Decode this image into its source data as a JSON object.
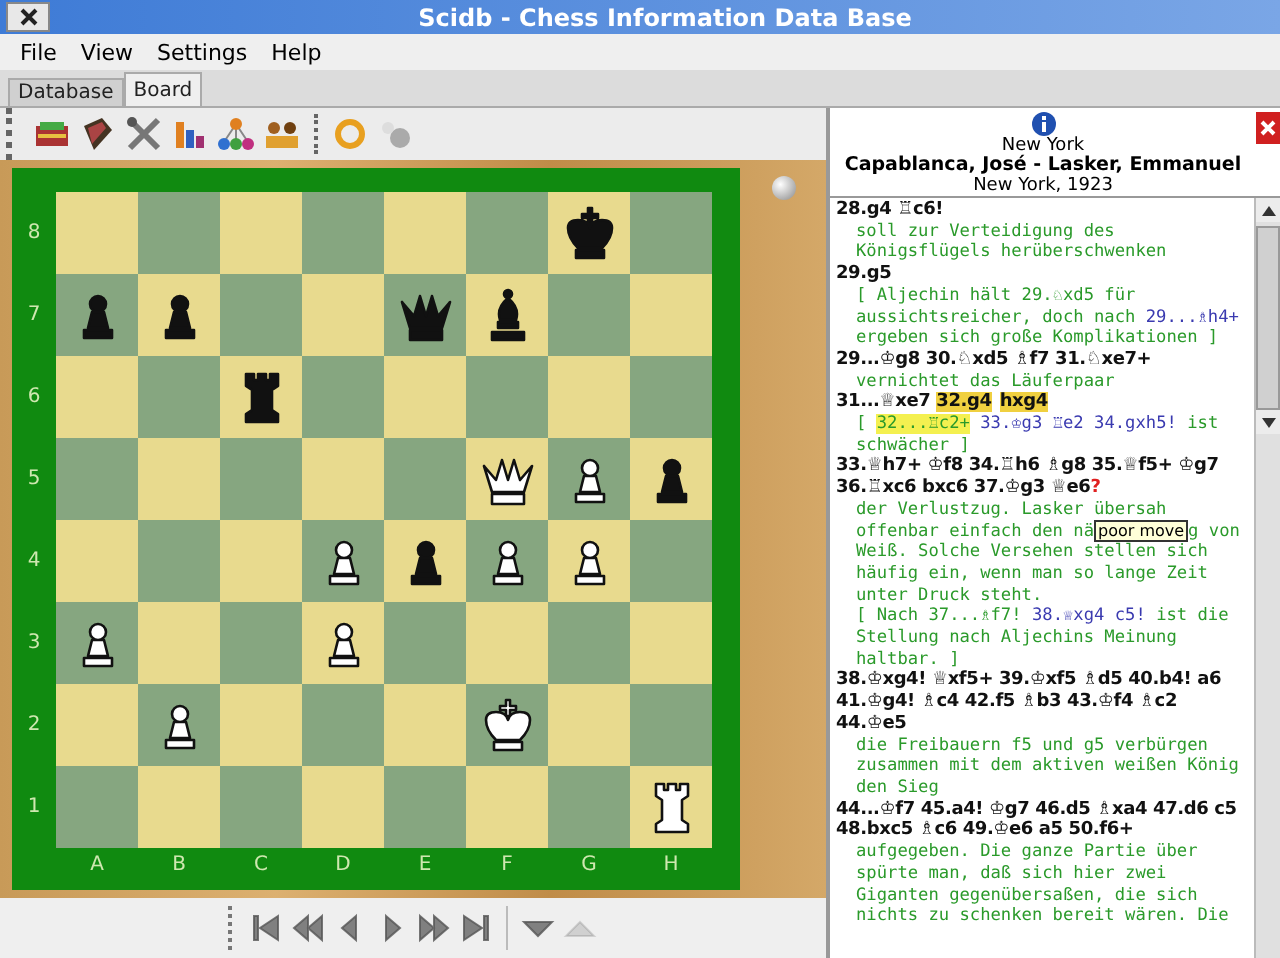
{
  "window": {
    "title": "Scidb - Chess Information Data Base"
  },
  "menu": [
    {
      "label": "File"
    },
    {
      "label": "View"
    },
    {
      "label": "Settings"
    },
    {
      "label": "Help"
    }
  ],
  "tabs": [
    {
      "label": "Database",
      "selected": false
    },
    {
      "label": "Board",
      "selected": true
    }
  ],
  "board": {
    "ranks": [
      "8",
      "7",
      "6",
      "5",
      "4",
      "3",
      "2",
      "1"
    ],
    "files": [
      "A",
      "B",
      "C",
      "D",
      "E",
      "F",
      "G",
      "H"
    ],
    "rows": [
      [
        {
          "kind": "empty"
        },
        {
          "kind": "empty"
        },
        {
          "kind": "empty"
        },
        {
          "kind": "empty"
        },
        {
          "kind": "empty"
        },
        {
          "kind": "empty"
        },
        {
          "kind": "black-king"
        },
        {
          "kind": "empty"
        }
      ],
      [
        {
          "kind": "black-pawn"
        },
        {
          "kind": "black-pawn"
        },
        {
          "kind": "empty"
        },
        {
          "kind": "empty"
        },
        {
          "kind": "black-queen"
        },
        {
          "kind": "black-bishop"
        },
        {
          "kind": "empty"
        },
        {
          "kind": "empty"
        }
      ],
      [
        {
          "kind": "empty"
        },
        {
          "kind": "empty"
        },
        {
          "kind": "black-rook"
        },
        {
          "kind": "empty"
        },
        {
          "kind": "empty"
        },
        {
          "kind": "empty"
        },
        {
          "kind": "empty"
        },
        {
          "kind": "empty"
        }
      ],
      [
        {
          "kind": "empty"
        },
        {
          "kind": "empty"
        },
        {
          "kind": "empty"
        },
        {
          "kind": "empty"
        },
        {
          "kind": "empty"
        },
        {
          "kind": "white-queen"
        },
        {
          "kind": "white-pawn"
        },
        {
          "kind": "black-pawn"
        }
      ],
      [
        {
          "kind": "empty"
        },
        {
          "kind": "empty"
        },
        {
          "kind": "empty"
        },
        {
          "kind": "white-pawn"
        },
        {
          "kind": "black-pawn"
        },
        {
          "kind": "white-pawn"
        },
        {
          "kind": "white-pawn"
        },
        {
          "kind": "empty"
        }
      ],
      [
        {
          "kind": "white-pawn"
        },
        {
          "kind": "empty"
        },
        {
          "kind": "empty"
        },
        {
          "kind": "white-pawn"
        },
        {
          "kind": "empty"
        },
        {
          "kind": "empty"
        },
        {
          "kind": "empty"
        },
        {
          "kind": "empty"
        }
      ],
      [
        {
          "kind": "empty"
        },
        {
          "kind": "white-pawn"
        },
        {
          "kind": "empty"
        },
        {
          "kind": "empty"
        },
        {
          "kind": "empty"
        },
        {
          "kind": "white-king"
        },
        {
          "kind": "empty"
        },
        {
          "kind": "empty"
        }
      ],
      [
        {
          "kind": "empty"
        },
        {
          "kind": "empty"
        },
        {
          "kind": "empty"
        },
        {
          "kind": "empty"
        },
        {
          "kind": "empty"
        },
        {
          "kind": "empty"
        },
        {
          "kind": "empty"
        },
        {
          "kind": "white-rook"
        }
      ]
    ]
  },
  "game_header": {
    "event": "New York",
    "players": "Capablanca, José - Lasker, Emmanuel",
    "site_date": "New York, 1923"
  },
  "notation": [
    {
      "kind": "move",
      "parts": [
        {
          "kind": "plain",
          "text": "28.g4 ♖c6!"
        }
      ]
    },
    {
      "kind": "comment",
      "parts": [
        {
          "kind": "plain",
          "text": "soll zur Verteidigung des Königsflügels herüberschwenken"
        }
      ]
    },
    {
      "kind": "move",
      "parts": [
        {
          "kind": "plain",
          "text": "29.g5"
        }
      ]
    },
    {
      "kind": "comment",
      "parts": [
        {
          "kind": "plain",
          "text": "[ Aljechin hält 29.♘xd5 für aussichtsreicher, doch nach "
        },
        {
          "kind": "variation",
          "text": "29...♗h4+"
        },
        {
          "kind": "plain",
          "text": " ergeben sich große Komplikationen ]"
        }
      ]
    },
    {
      "kind": "move",
      "parts": [
        {
          "kind": "plain",
          "text": "29...♔g8 30.♘xd5 ♗f7 31.♘xe7+"
        }
      ]
    },
    {
      "kind": "comment",
      "parts": [
        {
          "kind": "plain",
          "text": "vernichtet das Läuferpaar"
        }
      ]
    },
    {
      "kind": "move",
      "parts": [
        {
          "kind": "plain",
          "text": "31...♕xe7 "
        },
        {
          "kind": "current",
          "text": "32.g4"
        },
        {
          "kind": "current",
          "text": "hxg4"
        }
      ]
    },
    {
      "kind": "comment",
      "parts": [
        {
          "kind": "plain",
          "text": "[ "
        },
        {
          "kind": "highlight",
          "text": "32...♖c2+"
        },
        {
          "kind": "variation",
          "text": " 33.♔g3 ♖e2 34.gxh5!"
        },
        {
          "kind": "plain",
          "text": " ist schwächer ]"
        }
      ]
    },
    {
      "kind": "move",
      "parts": [
        {
          "kind": "plain",
          "text": "33.♕h7+ ♔f8 34.♖h6 ♗g8 35.♕f5+ ♔g7 36.♖xc6 bxc6 37.♔g3 ♕e6"
        },
        {
          "kind": "mark",
          "text": "?"
        }
      ]
    },
    {
      "kind": "comment",
      "parts": [
        {
          "kind": "plain",
          "text": "der Verlustzug. Lasker übersah offenbar einfach den nä"
        },
        {
          "kind": "tooltip",
          "text": "poor move"
        },
        {
          "kind": "plain",
          "text": "g von Weiß. Solche Versehen stellen sich häufig ein, wenn man so lange Zeit unter Druck steht."
        }
      ]
    },
    {
      "kind": "comment",
      "parts": [
        {
          "kind": "plain",
          "text": "[ Nach 37...♗f7! "
        },
        {
          "kind": "variation",
          "text": "38.♕xg4 c5!"
        },
        {
          "kind": "plain",
          "text": " ist die Stellung nach Aljechins Meinung haltbar. ]"
        }
      ]
    },
    {
      "kind": "move",
      "parts": [
        {
          "kind": "plain",
          "text": "38.♔xg4! ♕xf5+ 39.♔xf5 ♗d5 40.b4! a6 41.♔g4! ♗c4 42.f5 ♗b3 43.♔f4 ♗c2 44.♔e5"
        }
      ]
    },
    {
      "kind": "comment",
      "parts": [
        {
          "kind": "plain",
          "text": "die Freibauern f5 und g5 verbürgen zusammen mit dem aktiven weißen König den Sieg"
        }
      ]
    },
    {
      "kind": "move",
      "parts": [
        {
          "kind": "plain",
          "text": "44...♔f7 45.a4! ♔g7 46.d5 ♗xa4 47.d6 c5 48.bxc5 ♗c6 49.♔e6 a5 50.f6+"
        }
      ]
    },
    {
      "kind": "comment",
      "parts": [
        {
          "kind": "plain",
          "text": "aufgegeben. Die ganze Partie über spürte man, daß sich hier zwei Giganten gegenübersaßen, die sich nichts zu schenken bereit wären. Die"
        }
      ]
    }
  ],
  "navigation": [
    {
      "kind": "first",
      "disabled": false
    },
    {
      "kind": "fast-back",
      "disabled": false
    },
    {
      "kind": "back",
      "disabled": false
    },
    {
      "kind": "forward",
      "disabled": false
    },
    {
      "kind": "fast-forward",
      "disabled": false
    },
    {
      "kind": "last",
      "disabled": false
    },
    {
      "kind": "down",
      "disabled": false
    },
    {
      "kind": "up",
      "disabled": true
    }
  ]
}
